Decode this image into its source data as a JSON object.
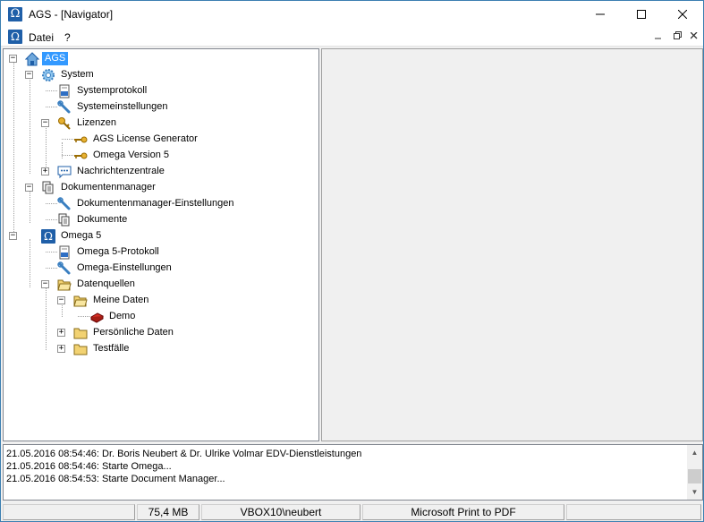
{
  "window": {
    "title": "AGS - [Navigator]"
  },
  "menu": {
    "items": [
      "Datei",
      "?"
    ]
  },
  "tree": {
    "root": "AGS",
    "system": "System",
    "systemprotokoll": "Systemprotokoll",
    "systemeinstellungen": "Systemeinstellungen",
    "lizenzen": "Lizenzen",
    "license_generator": "AGS License Generator",
    "omega_version": "Omega Version 5",
    "nachrichtenzentrale": "Nachrichtenzentrale",
    "dokumentenmanager": "Dokumentenmanager",
    "dokumentenmanager_einstellungen": "Dokumentenmanager-Einstellungen",
    "dokumente": "Dokumente",
    "omega5": "Omega 5",
    "omega5_protokoll": "Omega 5-Protokoll",
    "omega_einstellungen": "Omega-Einstellungen",
    "datenquellen": "Datenquellen",
    "meine_daten": "Meine Daten",
    "demo": "Demo",
    "persoenliche_daten": "Persönliche Daten",
    "testfaelle": "Testfälle"
  },
  "log": {
    "lines": [
      "21.05.2016 08:54:46: Dr. Boris Neubert & Dr. Ulrike Volmar EDV-Dienstleistungen",
      "21.05.2016 08:54:46: Starte Omega...",
      "21.05.2016 08:54:53: Starte Document Manager..."
    ]
  },
  "status": {
    "memory": "75,4 MB",
    "user": "VBOX10\\neubert",
    "printer": "Microsoft Print to PDF"
  },
  "colors": {
    "selection": "#3399ff",
    "app_icon": "#1f5fa8",
    "folder": "#f2d272"
  }
}
